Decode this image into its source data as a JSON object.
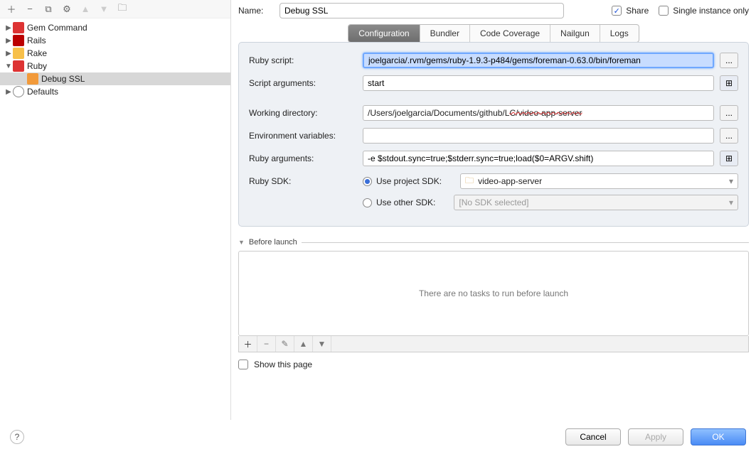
{
  "nameRow": {
    "label": "Name:",
    "value": "Debug SSL",
    "shareLabel": "Share",
    "shareChecked": true,
    "singleLabel": "Single instance only",
    "singleChecked": false
  },
  "tree": {
    "items": [
      {
        "label": "Gem Command",
        "icon": "ico-gem",
        "expanded": false
      },
      {
        "label": "Rails",
        "icon": "ico-rails",
        "expanded": false
      },
      {
        "label": "Rake",
        "icon": "ico-rake",
        "expanded": false
      },
      {
        "label": "Ruby",
        "icon": "ico-ruby",
        "expanded": true,
        "children": [
          {
            "label": "Debug SSL",
            "icon": "ico-debug",
            "selected": true
          }
        ]
      },
      {
        "label": "Defaults",
        "icon": "ico-defaults",
        "expanded": false
      }
    ]
  },
  "tabs": [
    "Configuration",
    "Bundler",
    "Code Coverage",
    "Nailgun",
    "Logs"
  ],
  "form": {
    "rubyScriptLabel": "Ruby script:",
    "rubyScriptValue": "joelgarcia/.rvm/gems/ruby-1.9.3-p484/gems/foreman-0.63.0/bin/foreman",
    "scriptArgsLabel": "Script arguments:",
    "scriptArgsValue": "start",
    "workDirLabel": "Working directory:",
    "workDirValuePrefix": "/Users/joelgarcia/Documents/github/L",
    "workDirValueRedacted": "C/video-app-server",
    "envVarsLabel": "Environment variables:",
    "envVarsValue": "",
    "rubyArgsLabel": "Ruby arguments:",
    "rubyArgsValue": "-e $stdout.sync=true;$stderr.sync=true;load($0=ARGV.shift)",
    "sdkLabel": "Ruby SDK:",
    "useProjectLabel": "Use project SDK:",
    "projectSdkValue": "video-app-server",
    "useOtherLabel": "Use other SDK:",
    "otherSdkValue": "[No SDK selected]"
  },
  "beforeLaunch": {
    "title": "Before launch",
    "empty": "There are no tasks to run before launch",
    "showLabel": "Show this page"
  },
  "footer": {
    "cancel": "Cancel",
    "apply": "Apply",
    "ok": "OK"
  }
}
